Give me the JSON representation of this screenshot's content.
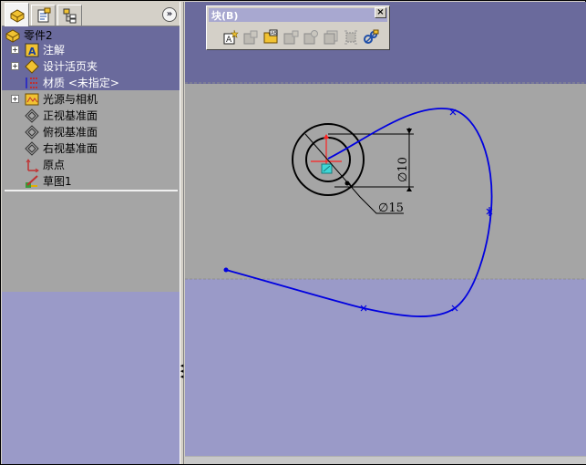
{
  "feature_tree": {
    "tabs": [
      {
        "icon": "feature-manager-icon"
      },
      {
        "icon": "property-manager-icon"
      },
      {
        "icon": "configuration-manager-icon"
      }
    ],
    "collapse_label": "»",
    "part_name": "零件2",
    "items": [
      {
        "label": "注解",
        "icon": "annotations-icon",
        "expandable": true
      },
      {
        "label": "设计活页夹",
        "icon": "design-binder-icon",
        "expandable": true
      },
      {
        "label": "材质 <未指定>",
        "icon": "material-icon",
        "expandable": false
      },
      {
        "label": "光源与相机",
        "icon": "lights-cameras-icon",
        "expandable": true
      },
      {
        "label": "正视基准面",
        "icon": "plane-icon",
        "expandable": false
      },
      {
        "label": "俯视基准面",
        "icon": "plane-icon",
        "expandable": false
      },
      {
        "label": "右视基准面",
        "icon": "plane-icon",
        "expandable": false
      },
      {
        "label": "原点",
        "icon": "origin-icon",
        "expandable": false
      },
      {
        "label": "草图1",
        "icon": "sketch-icon",
        "expandable": false
      }
    ]
  },
  "block_toolbar": {
    "title": "块(B)",
    "close_label": "×",
    "buttons": [
      "make-block-icon",
      "edit-block-icon",
      "insert-block-icon",
      "add-remove-block-icon",
      "rebuild-block-icon",
      "save-block-icon",
      "explode-block-icon",
      "belt-chain-icon"
    ]
  },
  "sketch": {
    "dimension_vertical": "∅10",
    "dimension_diameter": "∅15",
    "spline_color": "#0000e0"
  },
  "colors": {
    "viewport_top": "#6a6a9c",
    "viewport_mid": "#a5a5a5",
    "viewport_bottom": "#9a9ac8"
  }
}
